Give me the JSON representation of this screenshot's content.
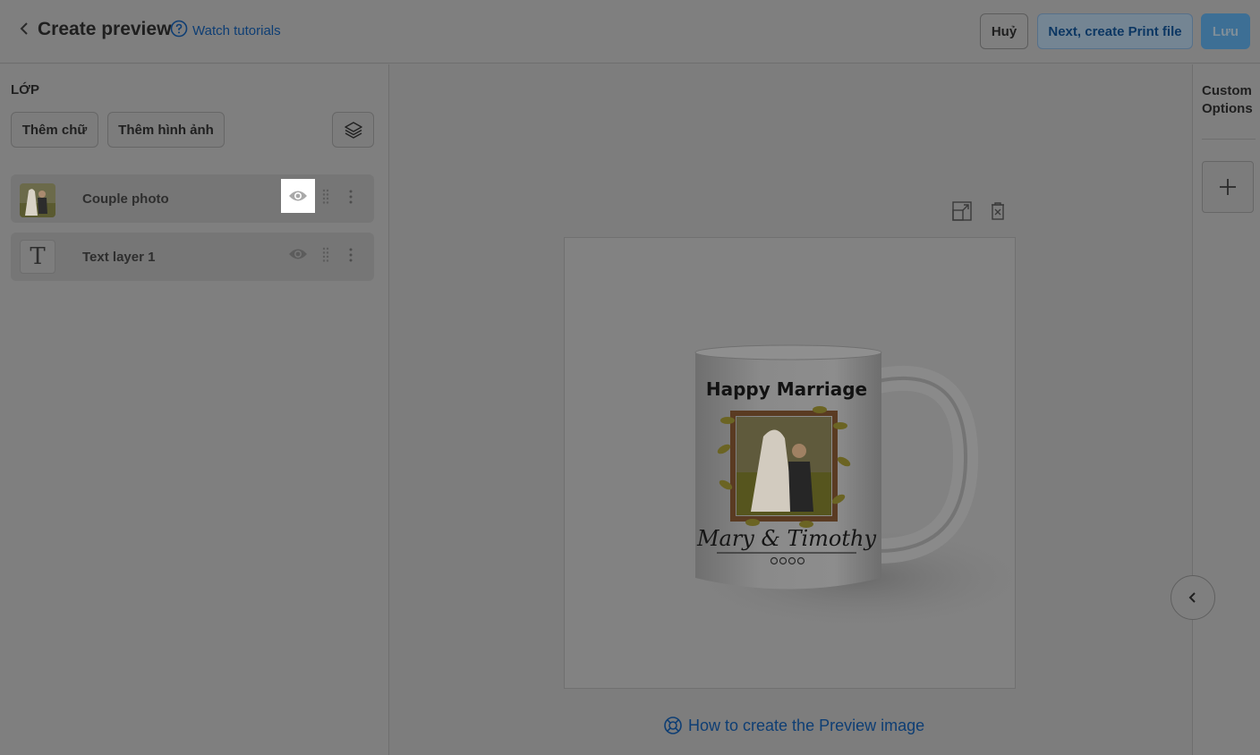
{
  "header": {
    "title": "Create preview",
    "watch_tutorials": "Watch tutorials",
    "cancel_label": "Huỷ",
    "next_label": "Next, create Print file",
    "save_label": "Lưu"
  },
  "layers_panel": {
    "heading": "LỚP",
    "add_text_label": "Thêm chữ",
    "add_image_label": "Thêm hình ảnh",
    "layers": [
      {
        "name": "Couple photo",
        "type": "image",
        "visible": true
      },
      {
        "name": "Text layer 1",
        "type": "text",
        "visible": true
      }
    ]
  },
  "canvas": {
    "mug_title": "Happy Marriage",
    "mug_names": "Mary & Timothy",
    "help_link": "How to create the Preview image"
  },
  "right_panel": {
    "title_line1": "Custom",
    "title_line2": "Options"
  },
  "colors": {
    "overlay_bg": "#7d7d7d",
    "link": "#0e3e74",
    "primary": "#3d6f95"
  }
}
